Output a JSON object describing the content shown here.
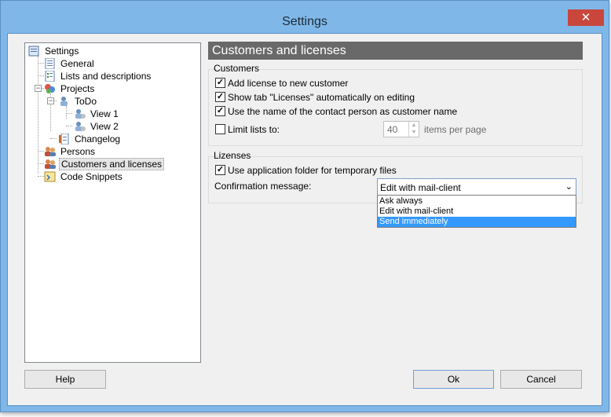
{
  "window": {
    "title": "Settings",
    "close_glyph": "✕"
  },
  "tree": {
    "items": [
      {
        "label": "Settings",
        "icon": "settings-icon"
      },
      {
        "label": "General",
        "icon": "document-icon"
      },
      {
        "label": "Lists and descriptions",
        "icon": "list-icon"
      },
      {
        "label": "Projects",
        "icon": "projects-icon"
      },
      {
        "label": "ToDo",
        "icon": "todo-icon"
      },
      {
        "label": "View 1",
        "icon": "view-icon"
      },
      {
        "label": "View 2",
        "icon": "view-icon"
      },
      {
        "label": "Changelog",
        "icon": "changelog-icon"
      },
      {
        "label": "Persons",
        "icon": "persons-icon"
      },
      {
        "label": "Customers and licenses",
        "icon": "customers-icon",
        "selected": true
      },
      {
        "label": "Code Snippets",
        "icon": "code-snippets-icon"
      }
    ]
  },
  "main": {
    "header": "Customers and licenses",
    "customers": {
      "title": "Customers",
      "options": [
        {
          "label": "Add license to new customer",
          "checked": true
        },
        {
          "label": "Show tab \"Licenses\" automatically on editing",
          "checked": true
        },
        {
          "label": "Use the name of the contact person as customer name",
          "checked": true
        },
        {
          "label": "Limit lists to:",
          "checked": false
        }
      ],
      "limit_value": "40",
      "items_per_page": "items per page"
    },
    "licenses": {
      "title": "Lizenses",
      "temp_folder_label": "Use application folder for temporary files",
      "temp_folder_checked": true,
      "confirmation_label": "Confirmation message:",
      "confirmation_value": "Edit with mail-client",
      "options": [
        "Ask always",
        "Edit with mail-client",
        "Send immediately"
      ],
      "highlighted_option": "Send immediately"
    }
  },
  "buttons": {
    "help": "Help",
    "ok": "Ok",
    "cancel": "Cancel"
  },
  "colors": {
    "header_bg": "#696969",
    "selection": "#3399ff",
    "titlebar": "#7fb8e8",
    "close": "#c9463d"
  }
}
